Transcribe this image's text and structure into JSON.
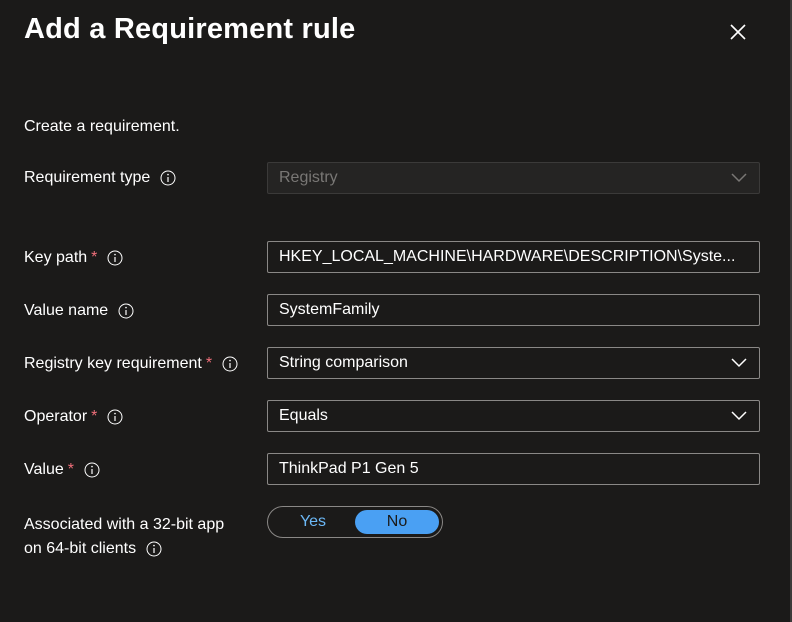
{
  "dialog": {
    "title": "Add a Requirement rule",
    "intro": "Create a requirement."
  },
  "form": {
    "requirement_type": {
      "label": "Requirement type",
      "value": "Registry",
      "disabled": true
    },
    "key_path": {
      "label": "Key path",
      "required": "*",
      "value": "HKEY_LOCAL_MACHINE\\HARDWARE\\DESCRIPTION\\Syste..."
    },
    "value_name": {
      "label": "Value name",
      "value": "SystemFamily"
    },
    "registry_key_requirement": {
      "label": "Registry key requirement",
      "required": "*",
      "value": "String comparison"
    },
    "operator": {
      "label": "Operator",
      "required": "*",
      "value": "Equals"
    },
    "value": {
      "label": "Value",
      "required": "*",
      "value": "ThinkPad P1 Gen 5"
    },
    "associated_32bit": {
      "label_line1": "Associated with a 32-bit app",
      "label_line2": "on 64-bit clients",
      "options": [
        "Yes",
        "No"
      ],
      "selected": "No"
    }
  },
  "icons": {
    "close": "close-icon",
    "info": "info-icon",
    "chevron": "chevron-down-icon"
  },
  "colors": {
    "background": "#1b1a19",
    "required_star": "#f1707b",
    "toggle_selected": "#4aa0f3",
    "toggle_unselected_text": "#6cb8f6",
    "border": "#8a8886"
  }
}
